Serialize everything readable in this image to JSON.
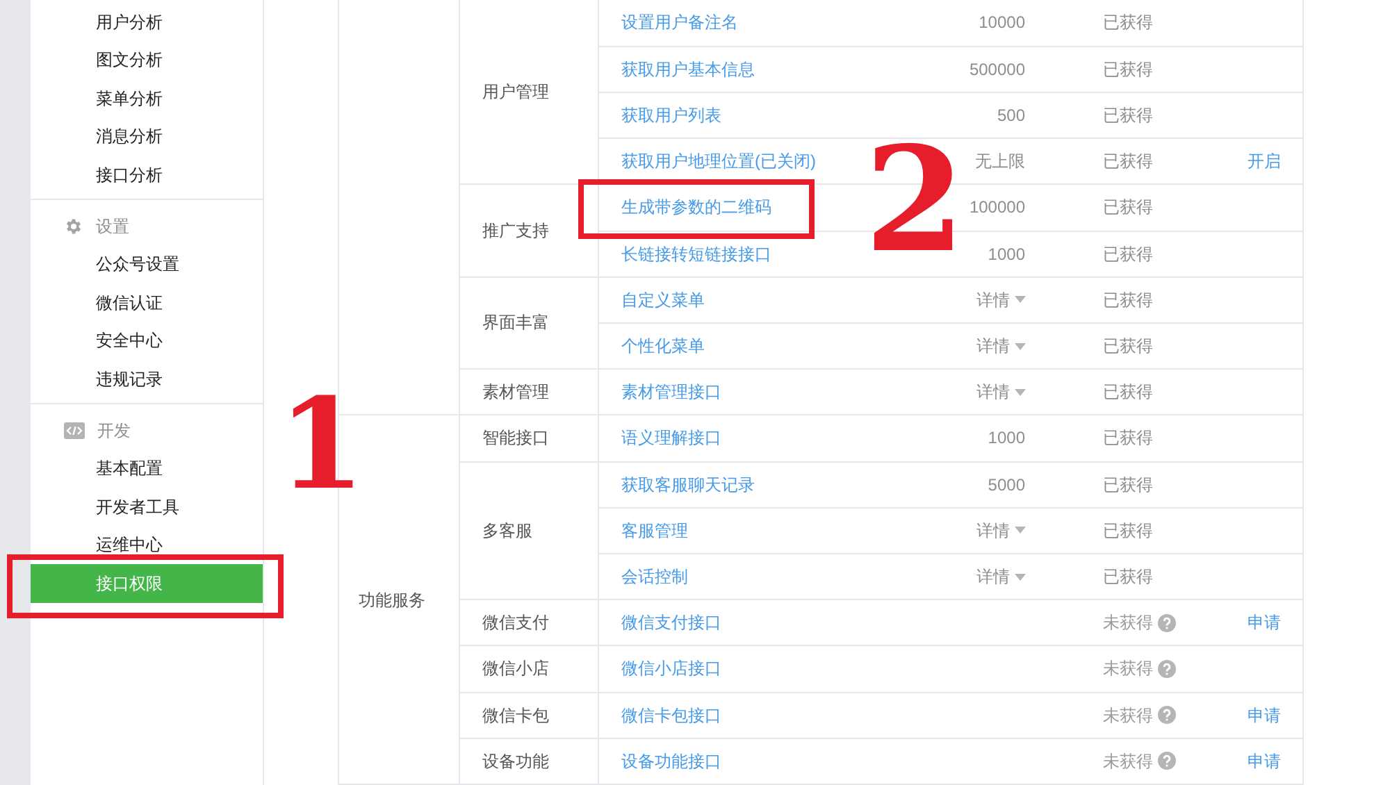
{
  "sidebar": {
    "sections": [
      {
        "items": [
          {
            "label": "用户分析",
            "selected": false,
            "circled": false
          },
          {
            "label": "图文分析",
            "selected": false,
            "circled": false
          },
          {
            "label": "菜单分析",
            "selected": false,
            "circled": false
          },
          {
            "label": "消息分析",
            "selected": false,
            "circled": false
          },
          {
            "label": "接口分析",
            "selected": false,
            "circled": false
          }
        ]
      },
      {
        "title": "设置",
        "kind": "gear",
        "items": [
          {
            "label": "公众号设置",
            "selected": false,
            "circled": false
          },
          {
            "label": "微信认证",
            "selected": false,
            "circled": false
          },
          {
            "label": "安全中心",
            "selected": false,
            "circled": false
          },
          {
            "label": "违规记录",
            "selected": false,
            "circled": false
          }
        ]
      },
      {
        "title": "开发",
        "kind": "code",
        "items": [
          {
            "label": "基本配置",
            "selected": false,
            "circled": false
          },
          {
            "label": "开发者工具",
            "selected": false,
            "circled": false
          },
          {
            "label": "运维中心",
            "selected": false,
            "circled": false
          },
          {
            "label": "接口权限",
            "selected": true,
            "circled": true
          }
        ]
      }
    ]
  },
  "table": {
    "groups": [
      {
        "categories": [
          {
            "label": "用户管理",
            "rows": [
              {
                "name": "设置用户备注名",
                "limit": "10000",
                "kind": "text",
                "status": "已获得",
                "obtained": true,
                "circled": false
              },
              {
                "name": "获取用户基本信息",
                "limit": "500000",
                "kind": "text",
                "status": "已获得",
                "obtained": true,
                "circled": false
              },
              {
                "name": "获取用户列表",
                "limit": "500",
                "kind": "text",
                "status": "已获得",
                "obtained": true,
                "circled": false
              },
              {
                "name": "获取用户地理位置(已关闭)",
                "limit": "无上限",
                "kind": "text",
                "status": "已获得",
                "obtained": true,
                "action": "开启",
                "circled": false
              }
            ]
          },
          {
            "label": "推广支持",
            "rows": [
              {
                "name": "生成带参数的二维码",
                "limit": "100000",
                "kind": "text",
                "status": "已获得",
                "obtained": true,
                "circled": true
              },
              {
                "name": "长链接转短链接接口",
                "limit": "1000",
                "kind": "text",
                "status": "已获得",
                "obtained": true,
                "circled": false
              }
            ]
          },
          {
            "label": "界面丰富",
            "rows": [
              {
                "name": "自定义菜单",
                "limit": "详情",
                "kind": "details",
                "status": "已获得",
                "obtained": true,
                "circled": false
              },
              {
                "name": "个性化菜单",
                "limit": "详情",
                "kind": "details",
                "status": "已获得",
                "obtained": true,
                "circled": false
              }
            ]
          },
          {
            "label": "素材管理",
            "rows": [
              {
                "name": "素材管理接口",
                "limit": "详情",
                "kind": "details",
                "status": "已获得",
                "obtained": true,
                "circled": false
              }
            ]
          }
        ]
      },
      {
        "label": "功能服务",
        "categories": [
          {
            "label": "智能接口",
            "rows": [
              {
                "name": "语义理解接口",
                "limit": "1000",
                "kind": "text",
                "status": "已获得",
                "obtained": true,
                "circled": false
              }
            ]
          },
          {
            "label": "多客服",
            "rows": [
              {
                "name": "获取客服聊天记录",
                "limit": "5000",
                "kind": "text",
                "status": "已获得",
                "obtained": true,
                "circled": false
              },
              {
                "name": "客服管理",
                "limit": "详情",
                "kind": "details",
                "status": "已获得",
                "obtained": true,
                "circled": false
              },
              {
                "name": "会话控制",
                "limit": "详情",
                "kind": "details",
                "status": "已获得",
                "obtained": true,
                "circled": false
              }
            ]
          },
          {
            "label": "微信支付",
            "rows": [
              {
                "name": "微信支付接口",
                "status": "未获得",
                "obtained": false,
                "action": "申请",
                "circled": false
              }
            ]
          },
          {
            "label": "微信小店",
            "rows": [
              {
                "name": "微信小店接口",
                "status": "未获得",
                "obtained": false,
                "circled": false
              }
            ]
          },
          {
            "label": "微信卡包",
            "rows": [
              {
                "name": "微信卡包接口",
                "status": "未获得",
                "obtained": false,
                "action": "申请",
                "circled": false
              }
            ]
          },
          {
            "label": "设备功能",
            "rows": [
              {
                "name": "设备功能接口",
                "status": "未获得",
                "obtained": false,
                "action": "申请",
                "circled": false
              }
            ]
          }
        ]
      }
    ]
  },
  "annotations": [
    {
      "label": "1"
    },
    {
      "label": "2"
    }
  ]
}
